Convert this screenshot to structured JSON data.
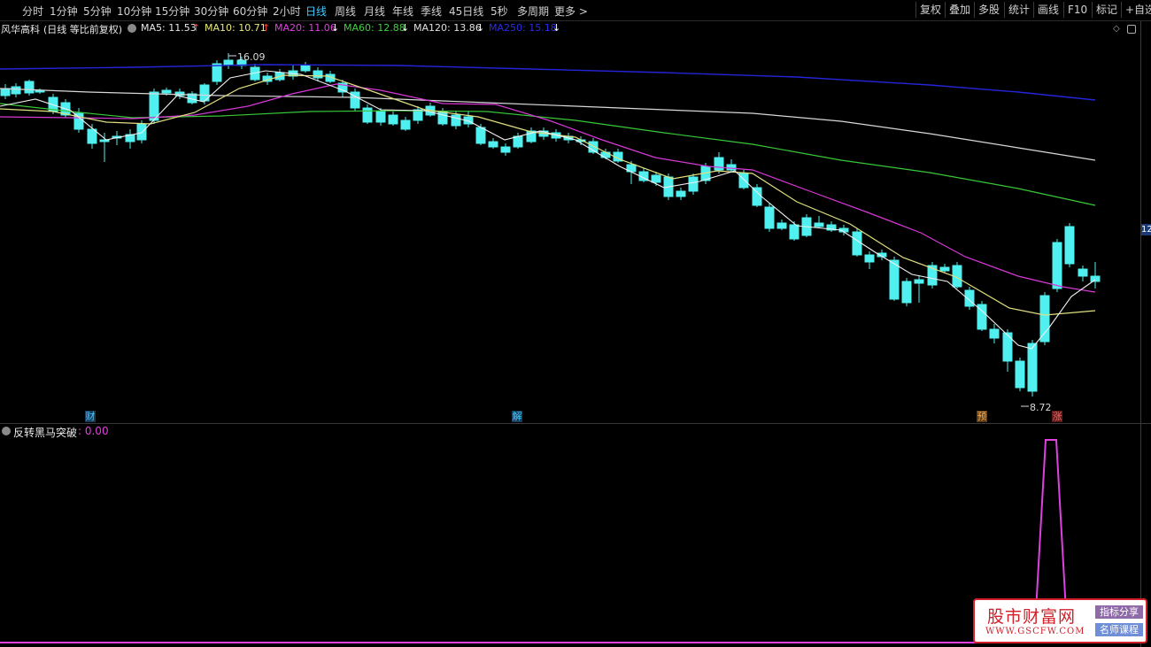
{
  "toolbar": {
    "timeframes": [
      "分时",
      "1分钟",
      "5分钟",
      "10分钟",
      "15分钟",
      "30分钟",
      "60分钟",
      "2小时",
      "日线",
      "周线",
      "月线",
      "年线",
      "季线",
      "45日线",
      "5秒",
      "多周期",
      "更多 >"
    ],
    "active": "日线",
    "right_buttons": [
      "复权",
      "叠加",
      "多股",
      "统计",
      "画线",
      "F10",
      "标记",
      "+自选"
    ]
  },
  "stock": {
    "name": "风华高科",
    "mode": "(日线 等比前复权)"
  },
  "ma": [
    {
      "label": "MA5: 11.53",
      "arrow": "↑",
      "color": "#e8e8e8",
      "arrow_color": "#ff4040"
    },
    {
      "label": "MA10: 10.71",
      "arrow": "↑",
      "color": "#e8e87a",
      "arrow_color": "#ff4040"
    },
    {
      "label": "MA20: 11.06",
      "arrow": "↓",
      "color": "#e040e0",
      "arrow_color": "#ffffff"
    },
    {
      "label": "MA60: 12.88",
      "arrow": "↓",
      "color": "#40d040",
      "arrow_color": "#ffffff"
    },
    {
      "label": "MA120: 13.86",
      "arrow": "↓",
      "color": "#e0e0e0",
      "arrow_color": "#ffffff"
    },
    {
      "label": "MA250: 15.18",
      "arrow": "↓",
      "color": "#2020e0",
      "arrow_color": "#ffffff"
    }
  ],
  "price": {
    "high_label": "16.09",
    "low_label": "8.72",
    "right_axis_tag": "12"
  },
  "event_markers": [
    {
      "label": "财",
      "bg": "#1a3a5a",
      "fg": "#40c8ff"
    },
    {
      "label": "解",
      "bg": "#1a3a5a",
      "fg": "#40c8ff"
    },
    {
      "label": "预",
      "bg": "#5a3a1a",
      "fg": "#ffb040"
    },
    {
      "label": "涨",
      "bg": "#5a1a1a",
      "fg": "#ff6060"
    }
  ],
  "indicator": {
    "name": "反转黑马突破",
    "value": ": 0.00",
    "color": "#e040e0"
  },
  "watermark": {
    "title": "股市财富网",
    "url": "WWW.GSCFW.COM",
    "badge1": "指标分享",
    "badge2": "名师课程"
  },
  "chart_data": {
    "type": "candlestick",
    "title": "风华高科",
    "annotations": [
      "16.09",
      "8.72"
    ],
    "series": [
      {
        "name": "MA5",
        "value": 11.53
      },
      {
        "name": "MA10",
        "value": 10.71
      },
      {
        "name": "MA20",
        "value": 11.06
      },
      {
        "name": "MA60",
        "value": 12.88
      },
      {
        "name": "MA120",
        "value": 13.86
      },
      {
        "name": "MA250",
        "value": 15.18
      }
    ],
    "indicator_series": {
      "name": "反转黑马突破",
      "last_value": 0.0
    }
  }
}
